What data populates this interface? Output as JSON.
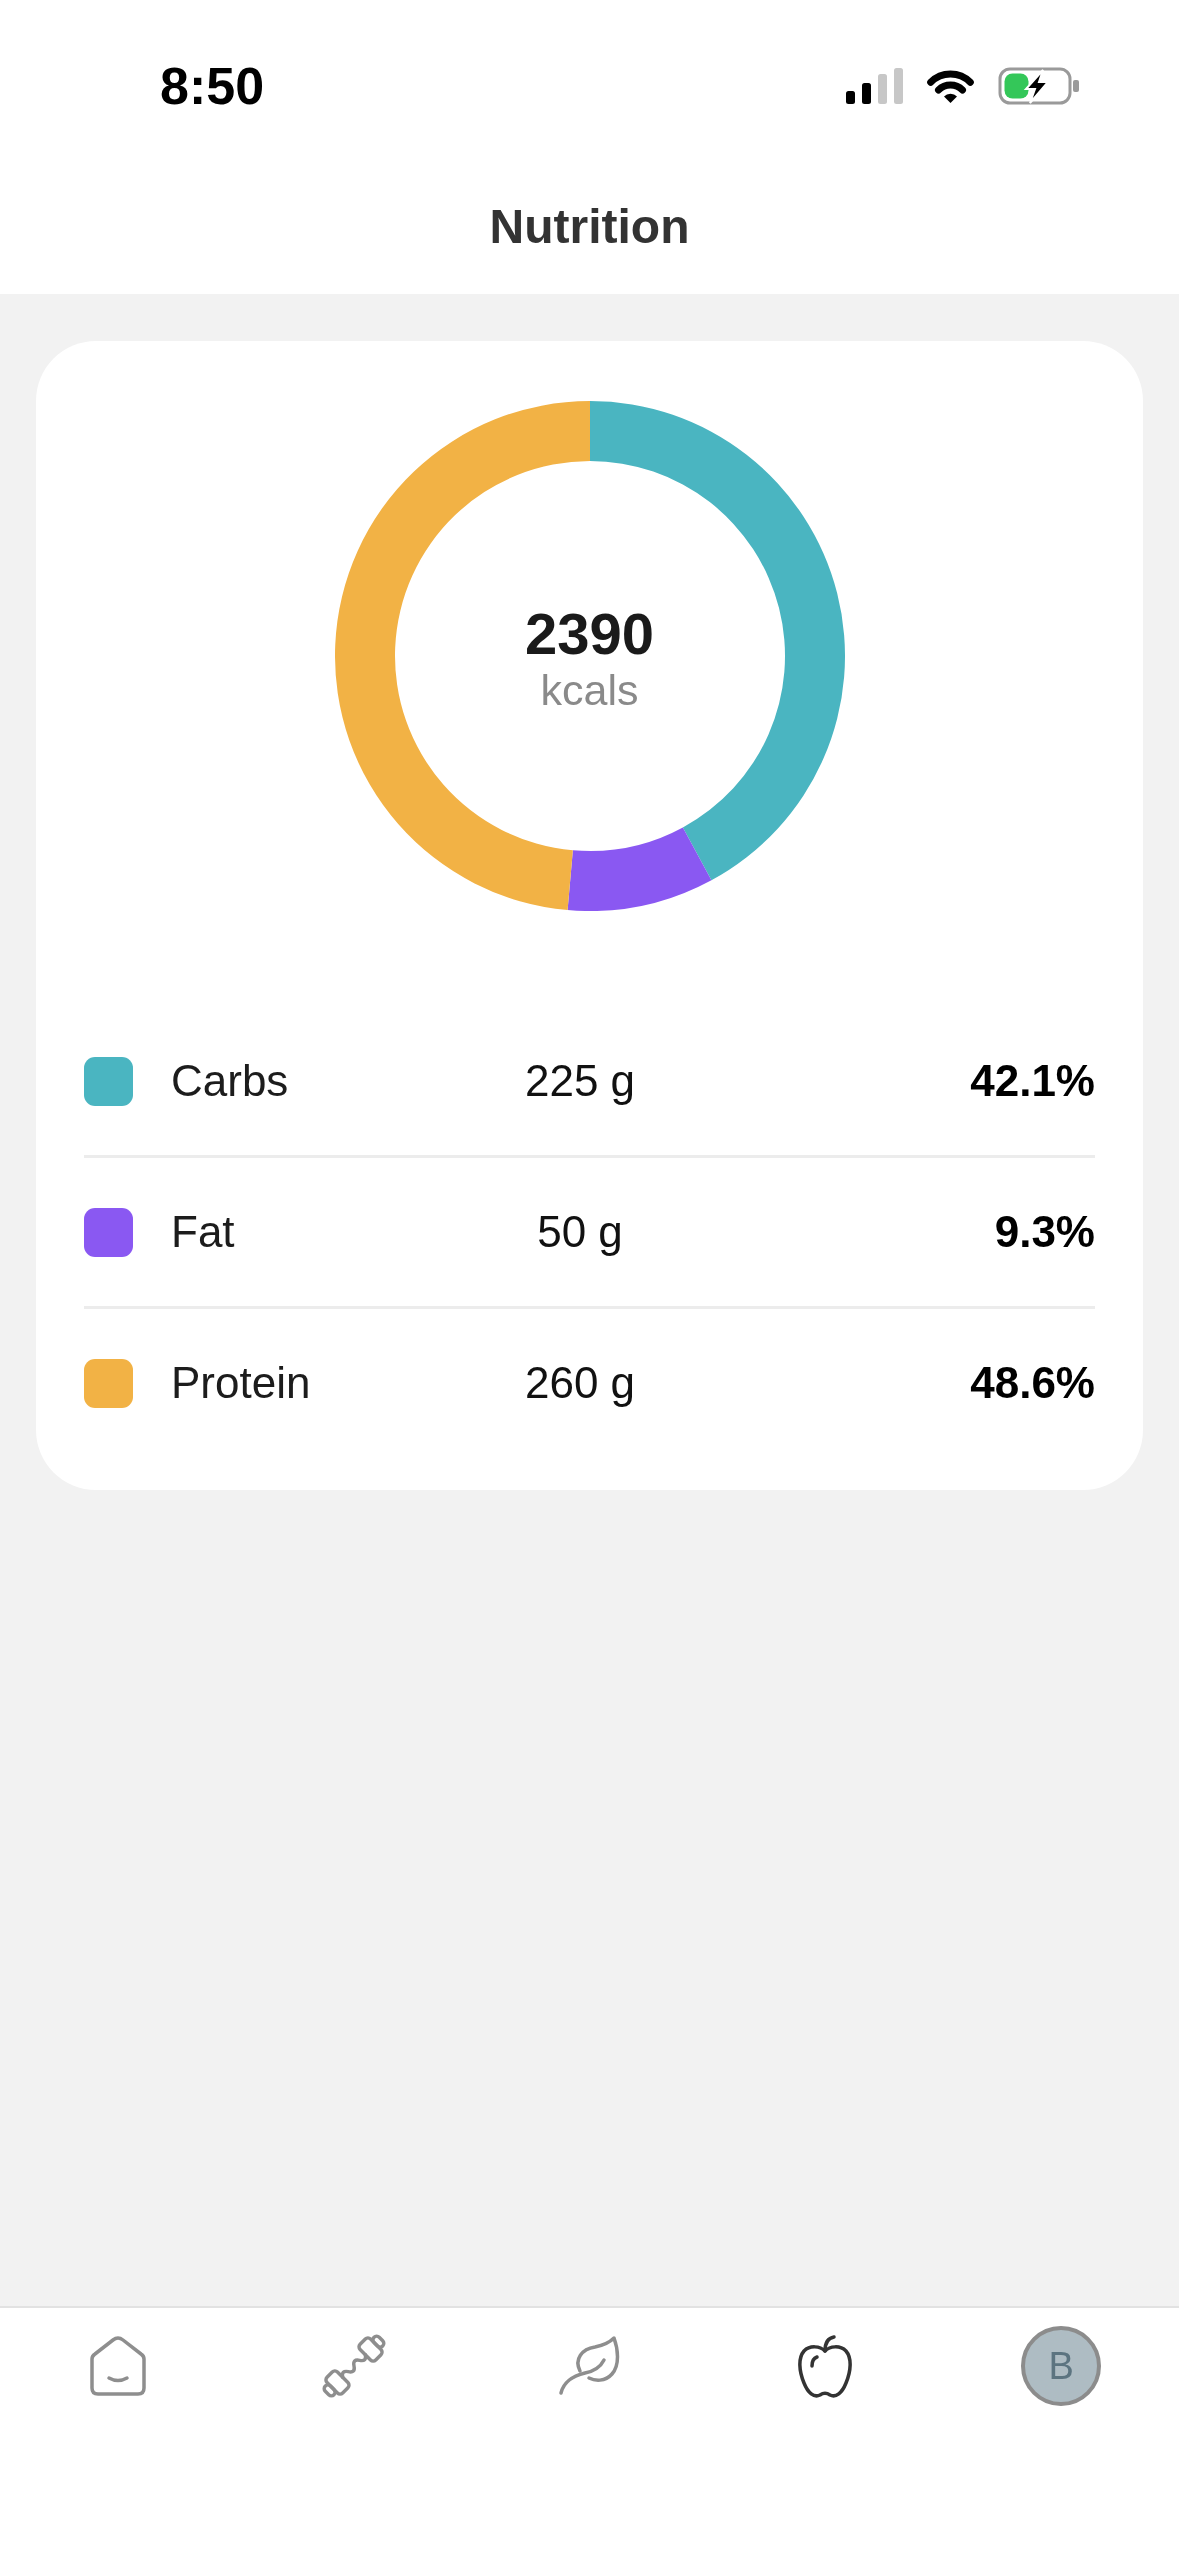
{
  "status_bar": {
    "time": "8:50"
  },
  "nav_bar": {
    "title": "Nutrition"
  },
  "summary": {
    "total": "2390",
    "unit": "kcals",
    "chart_data": {
      "type": "donut",
      "categories": [
        "Carbs",
        "Fat",
        "Protein"
      ],
      "values": [
        42.1,
        9.3,
        48.6
      ]
    }
  },
  "macros": [
    {
      "amount": "225 g",
      "percent": "42.1%",
      "color": "#4ab5c1"
    },
    {
      "amount": "50 g",
      "percent": "9.3%",
      "color": "#8a58f2"
    },
    {
      "amount": "260 g",
      "percent": "48.6%",
      "color": "#f2b245"
    }
  ],
  "tab_bar": {
    "items": [
      {
        "kind": "icon",
        "selected": false
      },
      {
        "kind": "icon",
        "selected": false
      },
      {
        "kind": "icon",
        "selected": false
      },
      {
        "kind": "icon",
        "selected": true
      },
      {
        "kind": "avatar",
        "label": "B",
        "selected": false
      }
    ]
  }
}
